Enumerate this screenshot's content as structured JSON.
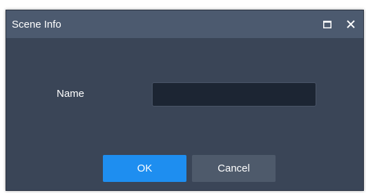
{
  "dialog": {
    "title": "Scene Info",
    "maximize_icon": "maximize-icon",
    "close_icon": "close-icon"
  },
  "form": {
    "name_label": "Name",
    "name_value": "",
    "name_placeholder": ""
  },
  "buttons": {
    "ok_label": "OK",
    "cancel_label": "Cancel"
  },
  "colors": {
    "titlebar": "#4c5a6f",
    "body": "#3a4557",
    "input_bg": "#1c2533",
    "ok_button": "#1e8ef0",
    "cancel_button": "#4e5a6b"
  }
}
